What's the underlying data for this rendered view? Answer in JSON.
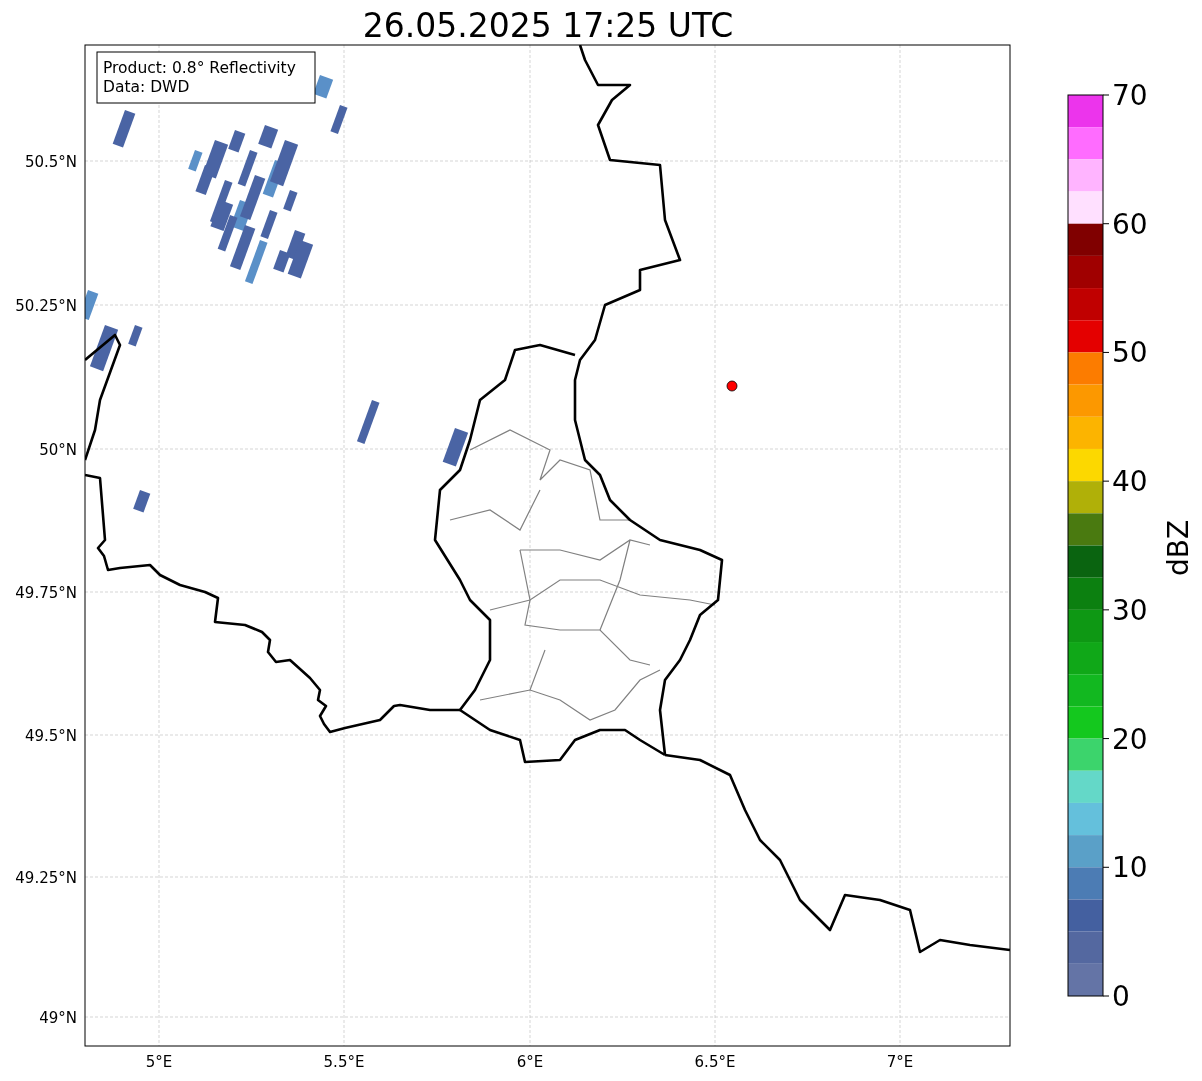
{
  "title": "26.05.2025 17:25 UTC",
  "info_box": [
    "Product: 0.8° Reflectivity",
    "Data: DWD"
  ],
  "map": {
    "yticks": [
      "50.5°N",
      "50.25°N",
      "50°N",
      "49.75°N",
      "49.5°N",
      "49.25°N",
      "49°N"
    ],
    "xticks": [
      "5°E",
      "5.5°E",
      "6°E",
      "6.5°E",
      "7°E"
    ]
  },
  "colorbar": {
    "label": "dBZ",
    "ticks": [
      "70",
      "60",
      "50",
      "40",
      "30",
      "20",
      "10",
      "0"
    ],
    "bands": [
      {
        "color": "#ec34ec"
      },
      {
        "color": "#ff6cff"
      },
      {
        "color": "#ffb4ff"
      },
      {
        "color": "#ffe0ff"
      },
      {
        "color": "#800000"
      },
      {
        "color": "#a00000"
      },
      {
        "color": "#c00000"
      },
      {
        "color": "#e40000"
      },
      {
        "color": "#fc7c00"
      },
      {
        "color": "#fc9800"
      },
      {
        "color": "#fcb400"
      },
      {
        "color": "#fcd800"
      },
      {
        "color": "#b0b008"
      },
      {
        "color": "#4a7a10"
      },
      {
        "color": "#0a6410"
      },
      {
        "color": "#0c8010"
      },
      {
        "color": "#0e9814"
      },
      {
        "color": "#10a818"
      },
      {
        "color": "#12b820"
      },
      {
        "color": "#14c81e"
      },
      {
        "color": "#3cd46c"
      },
      {
        "color": "#64d8c8"
      },
      {
        "color": "#64c0dc"
      },
      {
        "color": "#5aa0c8"
      },
      {
        "color": "#4c7cb4"
      },
      {
        "color": "#4460a0"
      },
      {
        "color": "#5468a0"
      },
      {
        "color": "#6474a6"
      }
    ]
  }
}
